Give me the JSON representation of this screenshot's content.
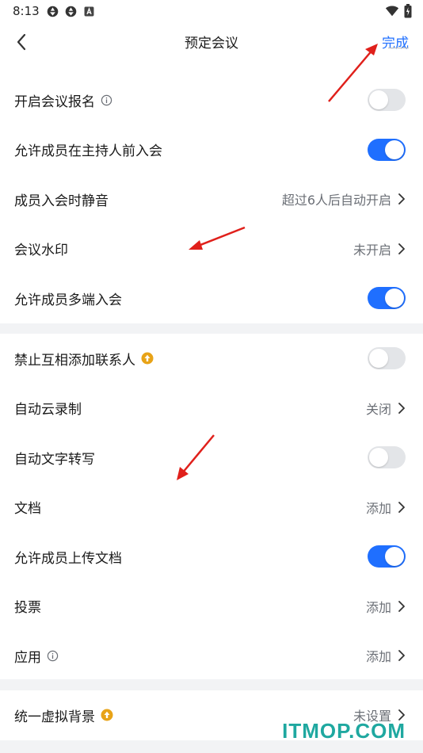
{
  "status_bar": {
    "time": "8:13",
    "left_icons": [
      "aperture-icon",
      "aperture-icon",
      "a-box-icon"
    ],
    "right_icons": [
      "wifi-icon",
      "battery-icon"
    ]
  },
  "nav": {
    "title": "预定会议",
    "back_icon": "back-chevron-icon",
    "done_label": "完成"
  },
  "groups": [
    {
      "rows": [
        {
          "label": "开启会议报名",
          "badge": "info-icon",
          "control": "toggle",
          "on": false
        },
        {
          "label": "允许成员在主持人前入会",
          "control": "toggle",
          "on": true
        },
        {
          "label": "成员入会时静音",
          "value": "超过6人后自动开启",
          "control": "chevron"
        },
        {
          "label": "会议水印",
          "value": "未开启",
          "control": "chevron"
        },
        {
          "label": "允许成员多端入会",
          "control": "toggle",
          "on": true
        }
      ]
    },
    {
      "rows": [
        {
          "label": "禁止互相添加联系人",
          "badge": "upgrade-icon",
          "control": "toggle",
          "on": false
        },
        {
          "label": "自动云录制",
          "value": "关闭",
          "control": "chevron"
        },
        {
          "label": "自动文字转写",
          "control": "toggle",
          "on": false
        },
        {
          "label": "文档",
          "value": "添加",
          "control": "chevron"
        },
        {
          "label": "允许成员上传文档",
          "control": "toggle",
          "on": true
        },
        {
          "label": "投票",
          "value": "添加",
          "control": "chevron"
        },
        {
          "label": "应用",
          "badge": "info-icon",
          "value": "添加",
          "control": "chevron"
        }
      ]
    },
    {
      "rows": [
        {
          "label": "统一虚拟背景",
          "badge": "upgrade-icon",
          "value": "未设置",
          "control": "chevron"
        }
      ]
    }
  ],
  "watermark_text": "ITMOP.COM",
  "colors": {
    "accent": "#1f6fff",
    "toggle_off": "#e3e5e8",
    "separator": "#f2f3f5",
    "badge_gold": "#e8a317",
    "annotation_arrow": "#e0201b",
    "watermark": "#1fa8a0"
  }
}
